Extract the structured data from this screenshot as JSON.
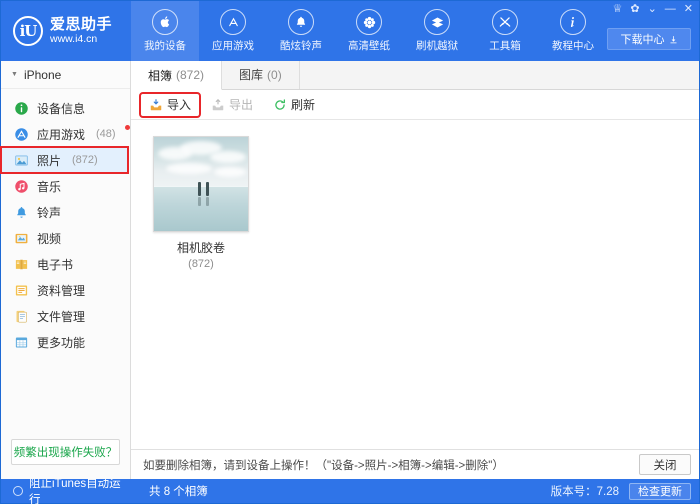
{
  "brand": {
    "name_cn": "爱思助手",
    "url": "www.i4.cn",
    "logo_text": "iU"
  },
  "header": {
    "nav": [
      {
        "label": "我的设备",
        "icon": "apple-icon",
        "active": true
      },
      {
        "label": "应用游戏",
        "icon": "appstore-icon",
        "active": false
      },
      {
        "label": "酷炫铃声",
        "icon": "bell-icon",
        "active": false
      },
      {
        "label": "高清壁纸",
        "icon": "flower-icon",
        "active": false
      },
      {
        "label": "刷机越狱",
        "icon": "flash-icon",
        "active": false
      },
      {
        "label": "工具箱",
        "icon": "tools-icon",
        "active": false
      },
      {
        "label": "教程中心",
        "icon": "info-icon",
        "active": false
      }
    ],
    "window_controls": [
      {
        "name": "skin-icon",
        "glyph": "♕"
      },
      {
        "name": "settings-gear-icon",
        "glyph": "✿"
      },
      {
        "name": "menu-collapse-icon",
        "glyph": "⌄"
      },
      {
        "name": "minimize-icon",
        "glyph": "—"
      },
      {
        "name": "close-icon",
        "glyph": "✕"
      }
    ],
    "download_center": {
      "label": "下载中心",
      "icon": "download-icon"
    }
  },
  "sidebar": {
    "device": {
      "name": "iPhone",
      "expanded": true
    },
    "items": [
      {
        "label": "设备信息",
        "count": "",
        "icon": "info-circle-icon",
        "selected": false,
        "badge": false
      },
      {
        "label": "应用游戏",
        "count": "(48)",
        "icon": "appstore-circle-icon",
        "selected": false,
        "badge": true
      },
      {
        "label": "照片",
        "count": "(872)",
        "icon": "photo-icon",
        "selected": true,
        "badge": false
      },
      {
        "label": "音乐",
        "count": "",
        "icon": "music-icon",
        "selected": false,
        "badge": false
      },
      {
        "label": "铃声",
        "count": "",
        "icon": "ringtone-bell-icon",
        "selected": false,
        "badge": false
      },
      {
        "label": "视频",
        "count": "",
        "icon": "video-icon",
        "selected": false,
        "badge": false
      },
      {
        "label": "电子书",
        "count": "",
        "icon": "book-icon",
        "selected": false,
        "badge": false
      },
      {
        "label": "资料管理",
        "count": "",
        "icon": "data-manage-icon",
        "selected": false,
        "badge": false
      },
      {
        "label": "文件管理",
        "count": "",
        "icon": "file-manage-icon",
        "selected": false,
        "badge": false
      },
      {
        "label": "更多功能",
        "count": "",
        "icon": "more-features-icon",
        "selected": false,
        "badge": false
      }
    ],
    "help_button": "频繁出现操作失败？"
  },
  "content": {
    "tabs": [
      {
        "label": "相簿",
        "count": "(872)",
        "active": true
      },
      {
        "label": "图库",
        "count": "(0)",
        "active": false
      }
    ],
    "toolbar": [
      {
        "label": "导入",
        "icon": "import-icon",
        "disabled": false,
        "highlighted": true
      },
      {
        "label": "导出",
        "icon": "export-icon",
        "disabled": true,
        "highlighted": false
      },
      {
        "label": "刷新",
        "icon": "refresh-icon",
        "disabled": false,
        "highlighted": false
      }
    ],
    "albums": [
      {
        "title": "相机胶卷",
        "count": "(872)"
      }
    ],
    "notice": {
      "text": "如要删除相簿，请到设备上操作！（\"设备->照片->相簿->编辑->删除\"）",
      "close_label": "关闭"
    }
  },
  "statusbar": {
    "itunes_toggle": "阻止iTunes自动运行",
    "summary": "共 8 个相簿",
    "version": "版本号：7.28",
    "update_label": "检查更新"
  },
  "colors": {
    "brand_blue": "#2f74e8",
    "nav_active": "#4a85ec",
    "highlight_red": "#e8262a",
    "selection_blue": "#e3f0fd",
    "green_text": "#1aa64b"
  }
}
